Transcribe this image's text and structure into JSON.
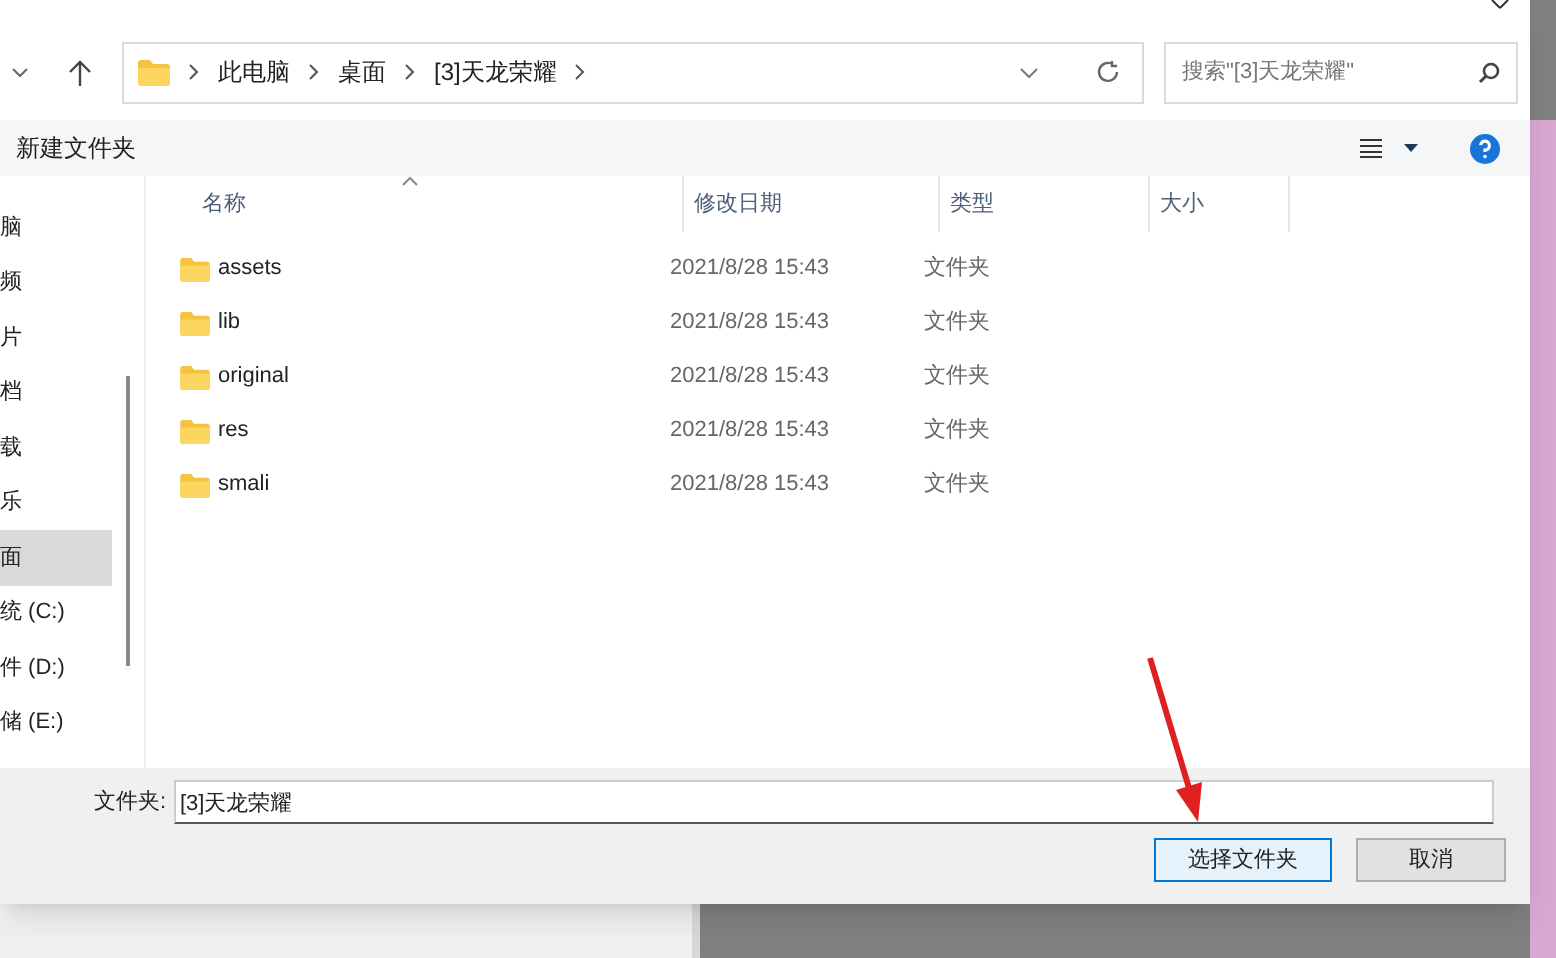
{
  "breadcrumb": [
    "此电脑",
    "桌面",
    "[3]天龙荣耀"
  ],
  "search": {
    "placeholder": "搜索\"[3]天龙荣耀\""
  },
  "toolbar": {
    "new_folder": "新建文件夹"
  },
  "sidebar": {
    "items": [
      {
        "label": "脑",
        "selected": false
      },
      {
        "label": "频",
        "selected": false
      },
      {
        "label": "片",
        "selected": false
      },
      {
        "label": "档",
        "selected": false
      },
      {
        "label": "载",
        "selected": false
      },
      {
        "label": "乐",
        "selected": false
      },
      {
        "label": "面",
        "selected": true
      },
      {
        "label": "统 (C:)",
        "selected": false
      },
      {
        "label": "件 (D:)",
        "selected": false
      },
      {
        "label": "储 (E:)",
        "selected": false
      }
    ]
  },
  "table": {
    "columns": [
      "名称",
      "修改日期",
      "类型",
      "大小"
    ],
    "rows": [
      {
        "name": "assets",
        "modified": "2021/8/28 15:43",
        "type": "文件夹"
      },
      {
        "name": "lib",
        "modified": "2021/8/28 15:43",
        "type": "文件夹"
      },
      {
        "name": "original",
        "modified": "2021/8/28 15:43",
        "type": "文件夹"
      },
      {
        "name": "res",
        "modified": "2021/8/28 15:43",
        "type": "文件夹"
      },
      {
        "name": "smali",
        "modified": "2021/8/28 15:43",
        "type": "文件夹"
      }
    ]
  },
  "footer": {
    "label": "文件夹:",
    "value": "[3]天龙荣耀",
    "buttons": [
      "选择文件夹",
      "取消"
    ]
  }
}
